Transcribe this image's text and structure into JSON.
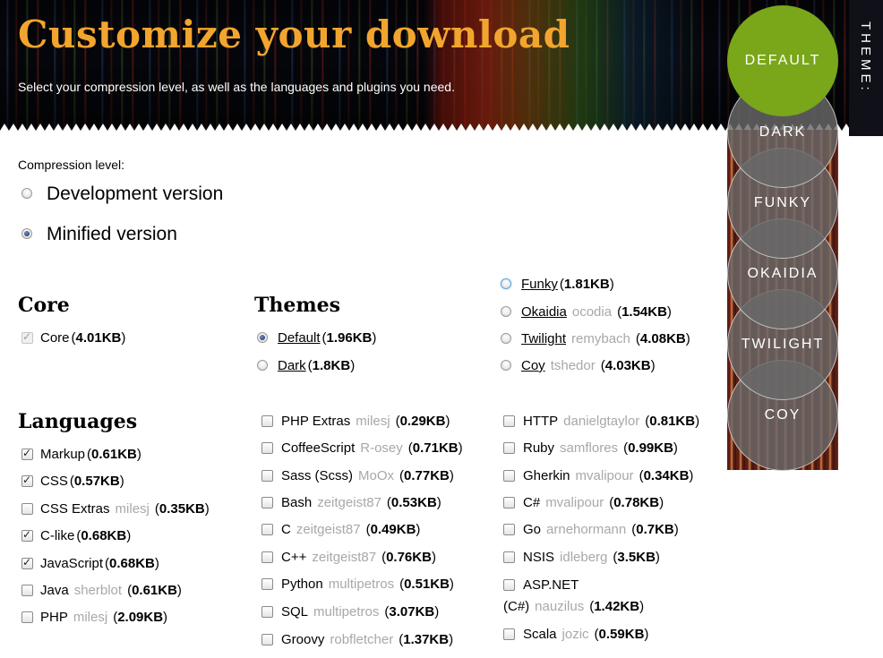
{
  "header": {
    "title": "Customize your download",
    "subtitle": "Select your compression level, as well as the languages and plugins you need."
  },
  "theme_switcher": {
    "tag": "THEME:",
    "options": [
      "DEFAULT",
      "DARK",
      "FUNKY",
      "OKAIDIA",
      "TWILIGHT",
      "COY"
    ],
    "selected": "DEFAULT",
    "colors": {
      "default": "#7aa61a",
      "grey": "#6e6e6e"
    }
  },
  "compression": {
    "label": "Compression level:",
    "options": [
      "Development version",
      "Minified version"
    ],
    "selected": "Minified version"
  },
  "core": {
    "heading": "Core",
    "items": [
      {
        "name": "Core",
        "size": "4.01KB",
        "checked": true,
        "disabled": true
      }
    ]
  },
  "themes": {
    "heading": "Themes",
    "items": [
      {
        "name": "Default",
        "author": "",
        "size": "1.96KB",
        "selected": true
      },
      {
        "name": "Dark",
        "author": "",
        "size": "1.8KB",
        "selected": false
      },
      {
        "name": "Funky",
        "author": "",
        "size": "1.81KB",
        "selected": false
      },
      {
        "name": "Okaidia",
        "author": "ocodia",
        "size": "1.54KB",
        "selected": false
      },
      {
        "name": "Twilight",
        "author": "remybach",
        "size": "4.08KB",
        "selected": false
      },
      {
        "name": "Coy",
        "author": "tshedor",
        "size": "4.03KB",
        "selected": false
      }
    ]
  },
  "languages": {
    "heading": "Languages",
    "col1": [
      {
        "name": "Markup",
        "author": "",
        "size": "0.61KB",
        "checked": true
      },
      {
        "name": "CSS",
        "author": "",
        "size": "0.57KB",
        "checked": true
      },
      {
        "name": "CSS Extras",
        "author": "milesj",
        "size": "0.35KB",
        "checked": false
      },
      {
        "name": "C-like",
        "author": "",
        "size": "0.68KB",
        "checked": true
      },
      {
        "name": "JavaScript",
        "author": "",
        "size": "0.68KB",
        "checked": true
      },
      {
        "name": "Java",
        "author": "sherblot",
        "size": "0.61KB",
        "checked": false
      },
      {
        "name": "PHP",
        "author": "milesj",
        "size": "2.09KB",
        "checked": false
      }
    ],
    "col2": [
      {
        "name": "PHP Extras",
        "author": "milesj",
        "size": "0.29KB",
        "checked": false
      },
      {
        "name": "CoffeeScript",
        "author": "R-osey",
        "size": "0.71KB",
        "checked": false
      },
      {
        "name": "Sass (Scss)",
        "author": "MoOx",
        "size": "0.77KB",
        "checked": false
      },
      {
        "name": "Bash",
        "author": "zeitgeist87",
        "size": "0.53KB",
        "checked": false
      },
      {
        "name": "C",
        "author": "zeitgeist87",
        "size": "0.49KB",
        "checked": false
      },
      {
        "name": "C++",
        "author": "zeitgeist87",
        "size": "0.76KB",
        "checked": false
      },
      {
        "name": "Python",
        "author": "multipetros",
        "size": "0.51KB",
        "checked": false
      },
      {
        "name": "SQL",
        "author": "multipetros",
        "size": "3.07KB",
        "checked": false
      },
      {
        "name": "Groovy",
        "author": "robfletcher",
        "size": "1.37KB",
        "checked": false
      }
    ],
    "col3": [
      {
        "name": "HTTP",
        "author": "danielgtaylor",
        "size": "0.81KB",
        "checked": false
      },
      {
        "name": "Ruby",
        "author": "samflores",
        "size": "0.99KB",
        "checked": false
      },
      {
        "name": "Gherkin",
        "author": "mvalipour",
        "size": "0.34KB",
        "checked": false
      },
      {
        "name": "C#",
        "author": "mvalipour",
        "size": "0.78KB",
        "checked": false
      },
      {
        "name": "Go",
        "author": "arnehormann",
        "size": "0.7KB",
        "checked": false
      },
      {
        "name": "NSIS",
        "author": "idleberg",
        "size": "3.5KB",
        "checked": false
      },
      {
        "name": "ASP.NET",
        "name_line2": "(C#)",
        "author": "nauzilus",
        "size": "1.42KB",
        "checked": false
      },
      {
        "name": "Scala",
        "author": "jozic",
        "size": "0.59KB",
        "checked": false
      }
    ]
  }
}
